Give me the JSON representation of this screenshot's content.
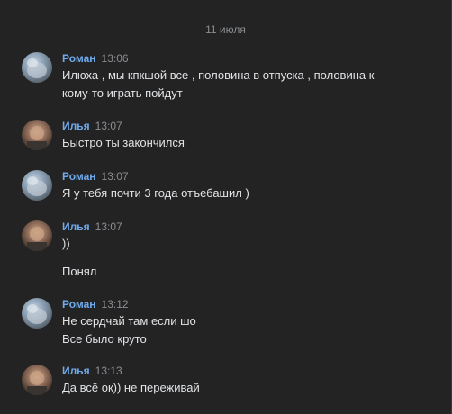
{
  "date_separator": "11 июля",
  "messages": [
    {
      "author": "Роман",
      "time": "13:06",
      "avatar": "roman",
      "lines": [
        "Илюха , мы кпкшой все , половина в отпуска , половина к",
        "кому-то играть пойдут"
      ]
    },
    {
      "author": "Илья",
      "time": "13:07",
      "avatar": "ilya",
      "lines": [
        "Быстро ты закончился"
      ]
    },
    {
      "author": "Роман",
      "time": "13:07",
      "avatar": "roman",
      "lines": [
        "Я у тебя почти 3 года отъебашил )"
      ]
    },
    {
      "author": "Илья",
      "time": "13:07",
      "avatar": "ilya",
      "lines": [
        "))",
        "Понял"
      ]
    },
    {
      "author": "Роман",
      "time": "13:12",
      "avatar": "roman",
      "lines": [
        "Не сердчай там если шо",
        "Все было круто"
      ]
    },
    {
      "author": "Илья",
      "time": "13:13",
      "avatar": "ilya",
      "lines": [
        "Да всё ок)) не переживай"
      ]
    }
  ],
  "colors": {
    "background": "#232323",
    "author": "#71aaeb",
    "muted": "#8a8d91",
    "text": "#e1e3e6"
  }
}
